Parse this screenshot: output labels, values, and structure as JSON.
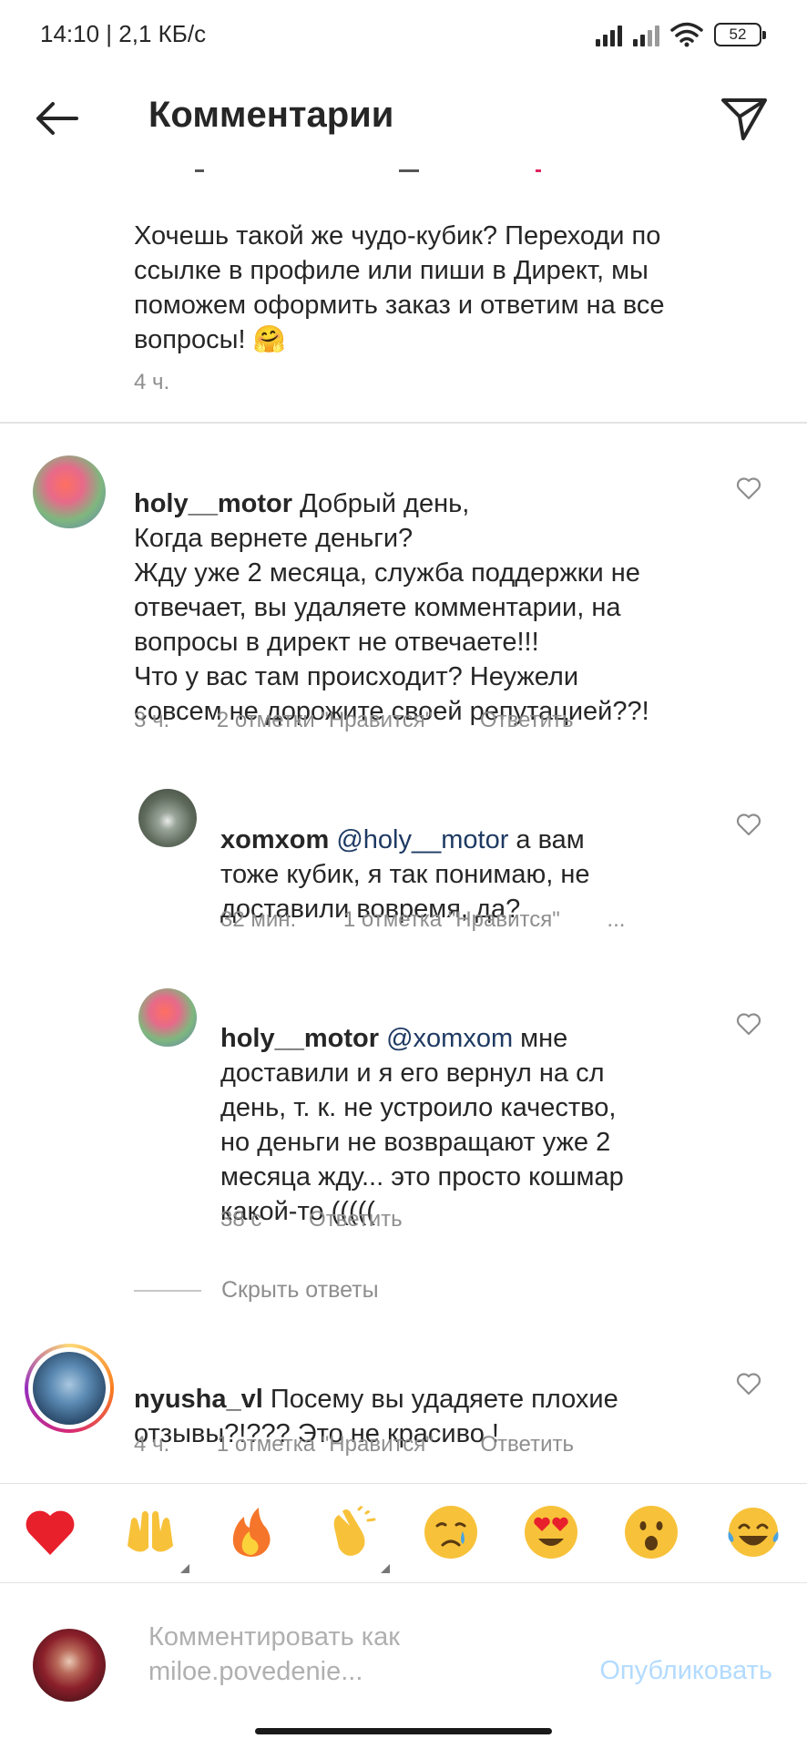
{
  "status_bar": {
    "text": "14:10 | 2,1 КБ/с",
    "battery": "52"
  },
  "header": {
    "title": "Комментарии"
  },
  "caption": {
    "text": "Хочешь такой же чудо-кубик? Переходи по\nссылке в профиле или пиши в Директ, мы\nпоможем оформить заказ и ответим на все\nвопросы! 🤗",
    "time": "4 ч."
  },
  "comments": [
    {
      "username": "holy__motor",
      "text": " Добрый день,\nКогда вернете деньги?\nЖду уже 2 месяца, служба поддержки не\nотвечает, вы удаляете комментарии, на\nвопросы в директ не отвечаете!!!\nЧто у вас там происходит? Неужели\nсовсем не дорожите своей репутацией??!",
      "time": "3 ч.",
      "likes": "2 отметки \"Нравится\"",
      "reply": "Ответить"
    },
    {
      "username": "xomxom",
      "mention": "@holy__motor",
      "text": " а вам\nтоже кубик, я так понимаю, не\nдоставили вовремя, да?",
      "time": "32 мин.",
      "likes": "1 отметка \"Нравится\"",
      "more": "..."
    },
    {
      "username": "holy__motor",
      "mention": "@xomxom",
      "text": " мне\nдоставили и я его вернул на сл\nдень, т. к. не устроило качество,\nно деньги не возвращают уже 2\nмесяца жду... это просто кошмар\nкакой-то (((((",
      "time": "38 с",
      "reply": "Ответить"
    },
    {
      "username": "nyusha_vl",
      "text": " Посему вы удадяете плохие\nотзывы?!??? Это не красиво !",
      "time": "4 ч.",
      "likes": "1 отметка \"Нравится\"",
      "reply": "Ответить"
    }
  ],
  "hide_replies": "Скрыть ответы",
  "emoji_bar": [
    "❤️",
    "🙌",
    "🔥",
    "👏",
    "😢",
    "😍",
    "😮",
    "😂"
  ],
  "composer": {
    "placeholder": "Комментировать как\nmiloe.povedenie...",
    "publish": "Опубликовать"
  },
  "colors": {
    "mention": "#1e3a63",
    "meta": "#8e8e8e",
    "publish": "#b3dbff",
    "story_ring": "#d6249f"
  }
}
